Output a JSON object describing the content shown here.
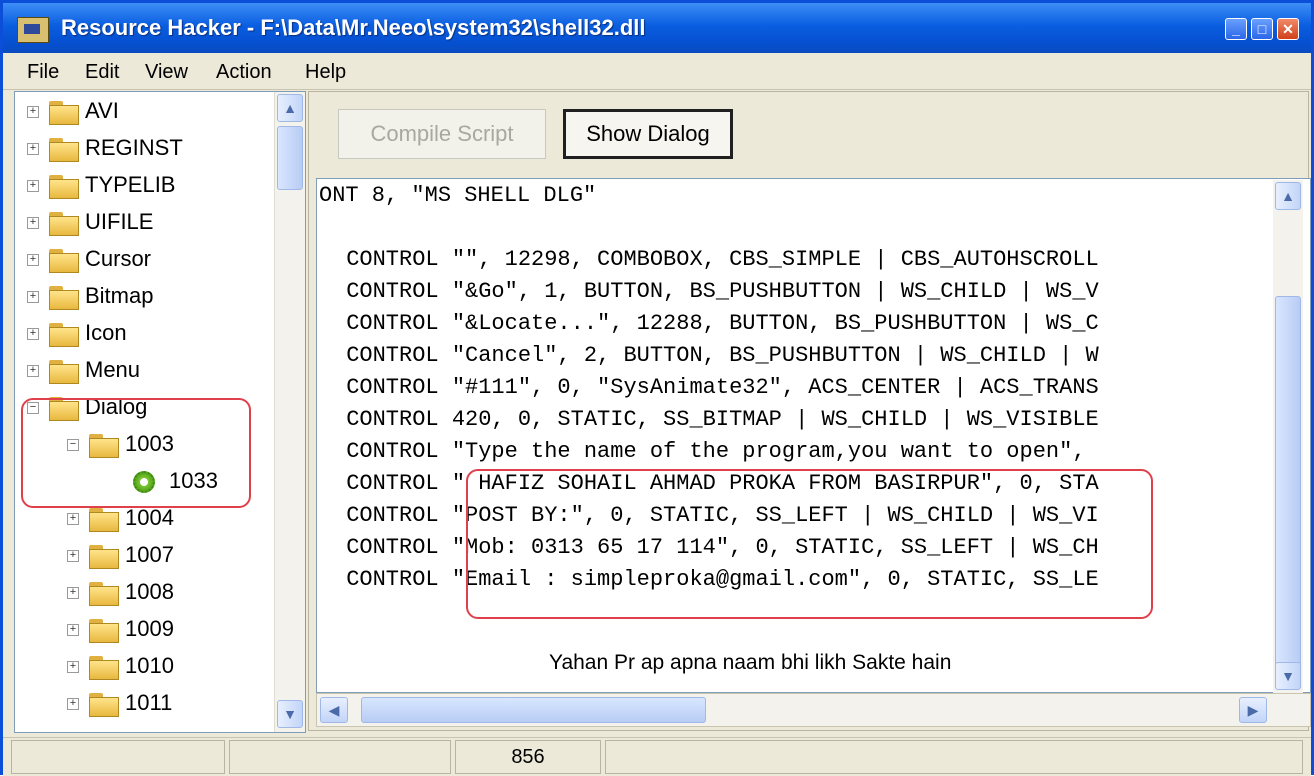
{
  "window": {
    "title": "Resource Hacker  -  F:\\Data\\Mr.Neeo\\system32\\shell32.dll",
    "controls": [
      "minimize-icon",
      "maximize-icon",
      "close-icon"
    ]
  },
  "menu": [
    "File",
    "Edit",
    "View",
    "Action",
    "Help"
  ],
  "tree": [
    {
      "label": "AVI",
      "icon": "folder-icon",
      "expander": "+"
    },
    {
      "label": "REGINST",
      "icon": "folder-icon",
      "expander": "+"
    },
    {
      "label": "TYPELIB",
      "icon": "folder-icon",
      "expander": "+"
    },
    {
      "label": "UIFILE",
      "icon": "folder-icon",
      "expander": "+"
    },
    {
      "label": "Cursor",
      "icon": "folder-icon",
      "expander": "+"
    },
    {
      "label": "Bitmap",
      "icon": "folder-icon",
      "expander": "+"
    },
    {
      "label": "Icon",
      "icon": "folder-icon",
      "expander": "+"
    },
    {
      "label": "Menu",
      "icon": "folder-icon",
      "expander": "+"
    },
    {
      "label": "Dialog",
      "icon": "folder-open-icon",
      "expander": "−"
    },
    {
      "label": "1003",
      "icon": "folder-open-icon",
      "expander": "−"
    },
    {
      "label": "1033",
      "icon": "gear-icon",
      "expander": ""
    },
    {
      "label": "1004",
      "icon": "folder-icon",
      "expander": "+"
    },
    {
      "label": "1007",
      "icon": "folder-icon",
      "expander": "+"
    },
    {
      "label": "1008",
      "icon": "folder-icon",
      "expander": "+"
    },
    {
      "label": "1009",
      "icon": "folder-icon",
      "expander": "+"
    },
    {
      "label": "1010",
      "icon": "folder-icon",
      "expander": "+"
    },
    {
      "label": "1011",
      "icon": "folder-icon",
      "expander": "+"
    }
  ],
  "buttons": {
    "compile": "Compile Script",
    "show": "Show Dialog"
  },
  "code": [
    "ONT 8, \"MS SHELL DLG\"",
    "",
    " CONTROL \"\", 12298, COMBOBOX, CBS_SIMPLE | CBS_AUTOHSCROLL",
    " CONTROL \"&Go\", 1, BUTTON, BS_PUSHBUTTON | WS_CHILD | WS_V",
    " CONTROL \"&Locate...\", 12288, BUTTON, BS_PUSHBUTTON | WS_C",
    " CONTROL \"Cancel\", 2, BUTTON, BS_PUSHBUTTON | WS_CHILD | W",
    " CONTROL \"#111\", 0, \"SysAnimate32\", ACS_CENTER | ACS_TRANS",
    " CONTROL 420, 0, STATIC, SS_BITMAP | WS_CHILD | WS_VISIBLE",
    " CONTROL \"Type the name of the program,you want to open\",",
    " CONTROL \" HAFIZ SOHAIL AHMAD PROKA FROM BASIRPUR\", 0, STA",
    " CONTROL \"POST BY:\", 0, STATIC, SS_LEFT | WS_CHILD | WS_VI",
    " CONTROL \"Mob: 0313 65 17 114\", 0, STATIC, SS_LEFT | WS_CH",
    " CONTROL \"Email : simpleproka@gmail.com\", 0, STATIC, SS_LE"
  ],
  "note": "Yahan Pr ap apna naam bhi likh Sakte hain",
  "status": {
    "cell1": "",
    "cell2": "",
    "cell3": "856",
    "cell4": ""
  },
  "colors": {
    "titlebar": "#0a5ee0",
    "highlight": "#e0404a"
  }
}
